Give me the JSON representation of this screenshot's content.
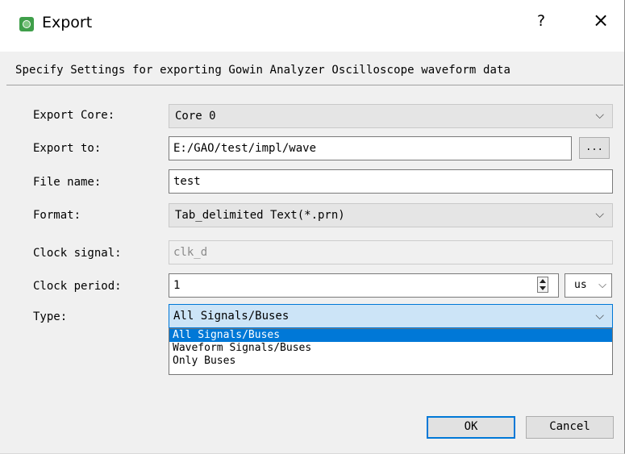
{
  "window": {
    "title": "Export",
    "help_label": "?",
    "close_label": "×"
  },
  "description": "Specify Settings for exporting Gowin Analyzer Oscilloscope waveform data",
  "form": {
    "export_core": {
      "label": "Export Core:",
      "value": "Core 0"
    },
    "export_to": {
      "label": "Export to:",
      "value": "E:/GAO/test/impl/wave",
      "browse_label": "..."
    },
    "file_name": {
      "label": "File name:",
      "value": "test"
    },
    "format": {
      "label": "Format:",
      "value": "Tab_delimited Text(*.prn)"
    },
    "clock_signal": {
      "label": "Clock signal:",
      "value": "clk_d"
    },
    "clock_period": {
      "label": "Clock period:",
      "value": "1",
      "unit": "us"
    },
    "type": {
      "label": "Type:",
      "value": "All Signals/Buses",
      "options": [
        "All Signals/Buses",
        "Waveform Signals/Buses",
        "Only Buses"
      ]
    }
  },
  "buttons": {
    "ok": "OK",
    "cancel": "Cancel"
  },
  "colors": {
    "accent": "#0078d7",
    "icon": "#3f9f4a"
  }
}
